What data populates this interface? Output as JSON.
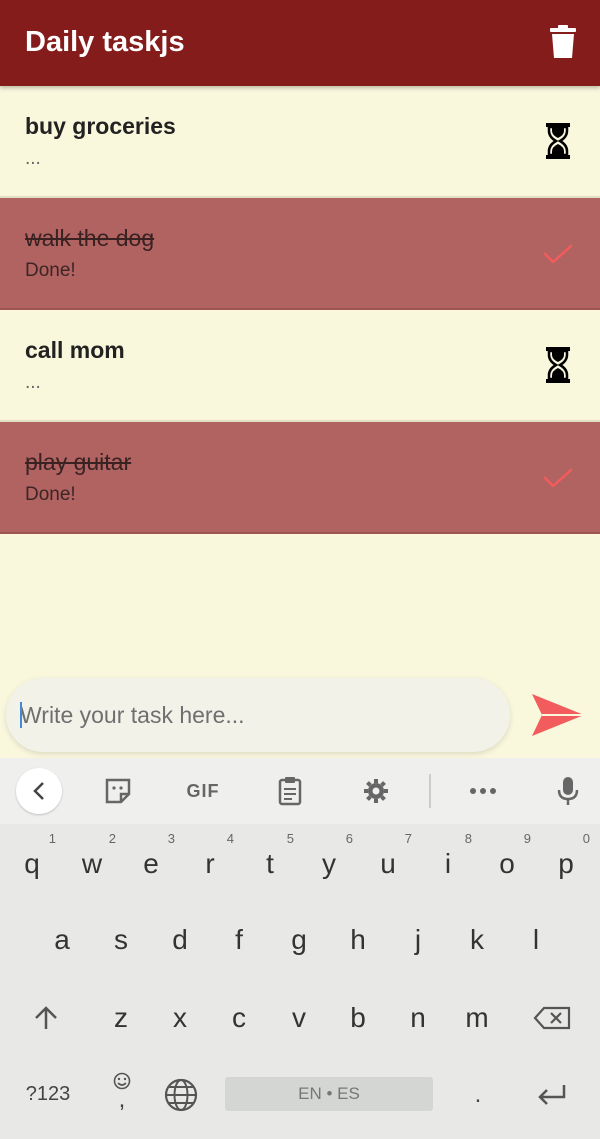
{
  "appbar": {
    "title": "Daily taskjs",
    "delete_icon": "trash-icon"
  },
  "tasks": [
    {
      "title": "buy groceries",
      "subtitle": "...",
      "done": false,
      "status_icon": "hourglass-icon"
    },
    {
      "title": "walk the dog",
      "subtitle": "Done!",
      "done": true,
      "status_icon": "check-icon"
    },
    {
      "title": "call mom",
      "subtitle": "...",
      "done": false,
      "status_icon": "hourglass-icon"
    },
    {
      "title": "play guitar",
      "subtitle": "Done!",
      "done": true,
      "status_icon": "check-icon"
    }
  ],
  "composer": {
    "placeholder": "Write your task here...",
    "value": "",
    "send_icon": "send-icon"
  },
  "keyboard": {
    "toolbar": {
      "back_icon": "chevron-left-icon",
      "sticker_icon": "sticker-icon",
      "gif_label": "GIF",
      "clipboard_icon": "clipboard-icon",
      "settings_icon": "gear-icon",
      "more_icon": "more-icon",
      "mic_icon": "mic-icon"
    },
    "row1": [
      {
        "k": "q",
        "h": "1"
      },
      {
        "k": "w",
        "h": "2"
      },
      {
        "k": "e",
        "h": "3"
      },
      {
        "k": "r",
        "h": "4"
      },
      {
        "k": "t",
        "h": "5"
      },
      {
        "k": "y",
        "h": "6"
      },
      {
        "k": "u",
        "h": "7"
      },
      {
        "k": "i",
        "h": "8"
      },
      {
        "k": "o",
        "h": "9"
      },
      {
        "k": "p",
        "h": "0"
      }
    ],
    "row2": [
      "a",
      "s",
      "d",
      "f",
      "g",
      "h",
      "j",
      "k",
      "l"
    ],
    "row3": [
      "z",
      "x",
      "c",
      "v",
      "b",
      "n",
      "m"
    ],
    "symbols_label": "?123",
    "comma_label": ",",
    "space_label": "EN • ES",
    "period_label": ".",
    "colors": {
      "appbar": "#851c1c",
      "done_row": "#b06361",
      "accent": "#f25c5c",
      "background": "#f9f7dc"
    }
  }
}
